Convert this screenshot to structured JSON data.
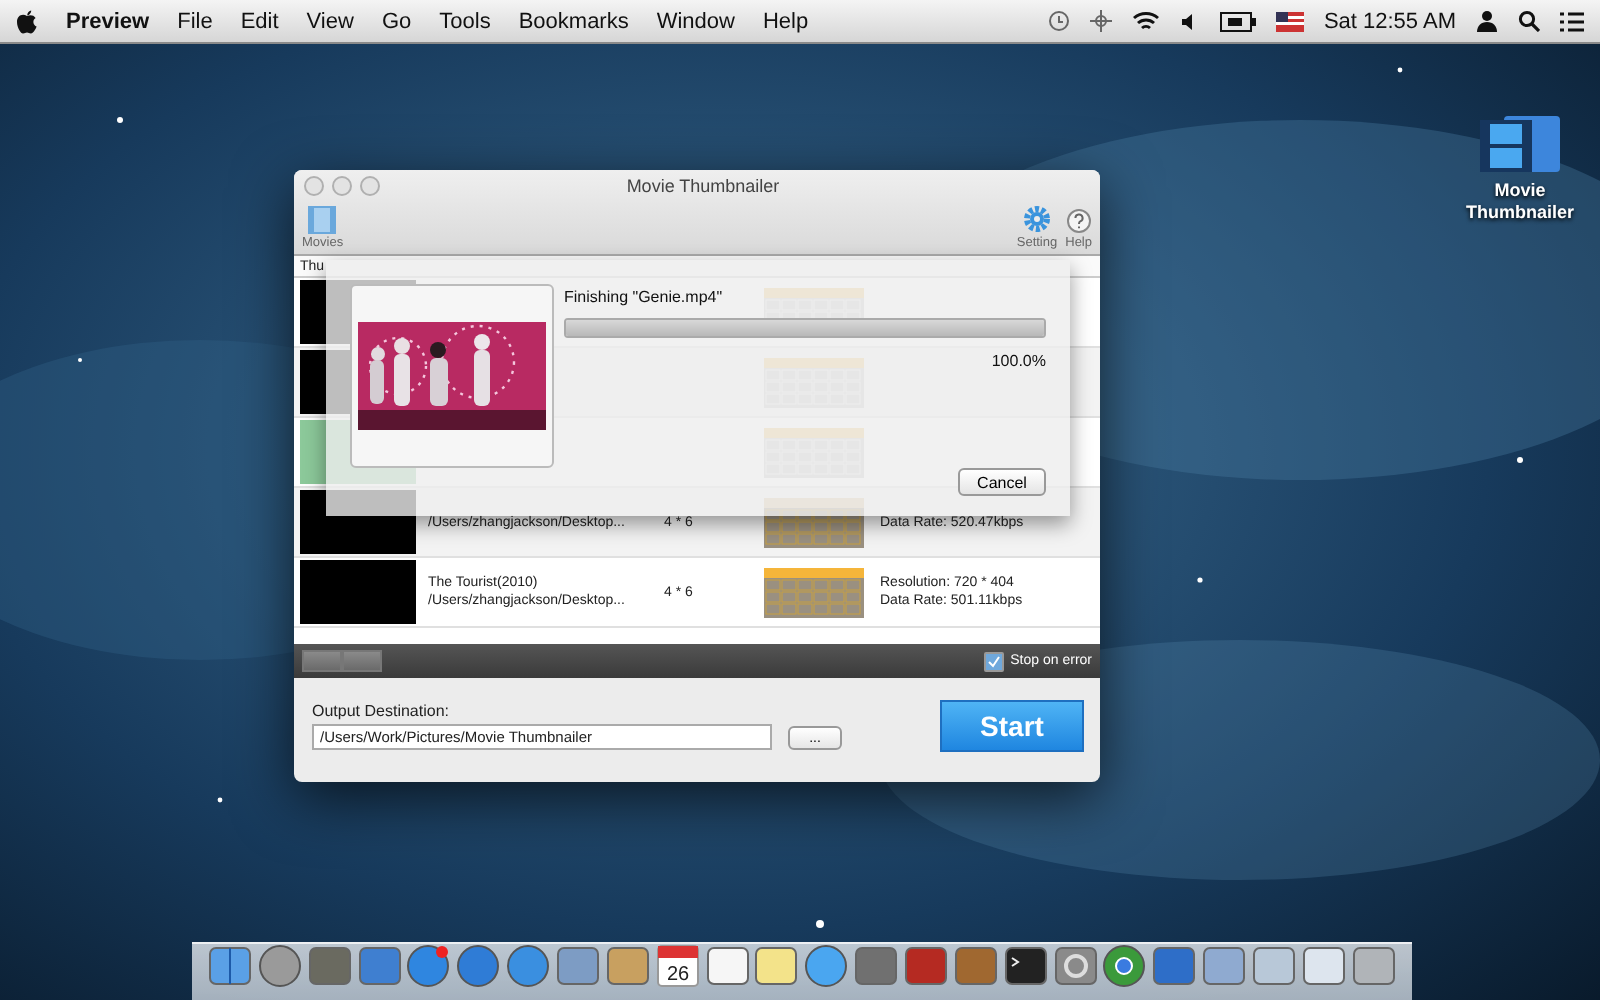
{
  "menu_bar": {
    "app": "Preview",
    "items": [
      "File",
      "Edit",
      "View",
      "Go",
      "Tools",
      "Bookmarks",
      "Window",
      "Help"
    ],
    "clock": "Sat 12:55 AM"
  },
  "desktop_icons": [
    {
      "label": "Movie Thumbnailer"
    }
  ],
  "window": {
    "title": "Movie Thumbnailer",
    "toolbar": {
      "left": [
        {
          "label": "Movies",
          "kind": "film"
        }
      ],
      "right": [
        {
          "label": "Setting",
          "kind": "gear"
        },
        {
          "label": "Help",
          "kind": "help"
        }
      ]
    },
    "table": {
      "columns": [
        "Thu"
      ],
      "rows": [
        {
          "color": "#000000",
          "kind": "faded"
        },
        {
          "color": "#000000",
          "kind": "faded"
        },
        {
          "color": "#8cc99a",
          "kind": "faded"
        },
        {
          "color": "#000000",
          "path": "/Users/zhangjackson/Desktop...",
          "grid": "4 * 6",
          "data_rate": "Data Rate: 520.47kbps",
          "kind": "plain"
        },
        {
          "color": "#000000",
          "title": "The Tourist(2010)",
          "path": "/Users/zhangjackson/Desktop...",
          "grid": "4 * 6",
          "resolution": "Resolution: 720 * 404",
          "data_rate": "Data Rate: 501.11kbps",
          "kind": "orange"
        }
      ]
    },
    "stop_on_error": {
      "label": "Stop on error",
      "checked": true
    },
    "output": {
      "label": "Output Destination:",
      "value": "/Users/Work/Pictures/Movie Thumbnailer",
      "browse": "...",
      "start": "Start"
    },
    "sheet": {
      "status": "Finishing \"Genie.mp4\"",
      "level": 1.0,
      "percent": "100.0%",
      "cancel": "Cancel"
    }
  },
  "dock": {
    "calendar_day": "26"
  }
}
